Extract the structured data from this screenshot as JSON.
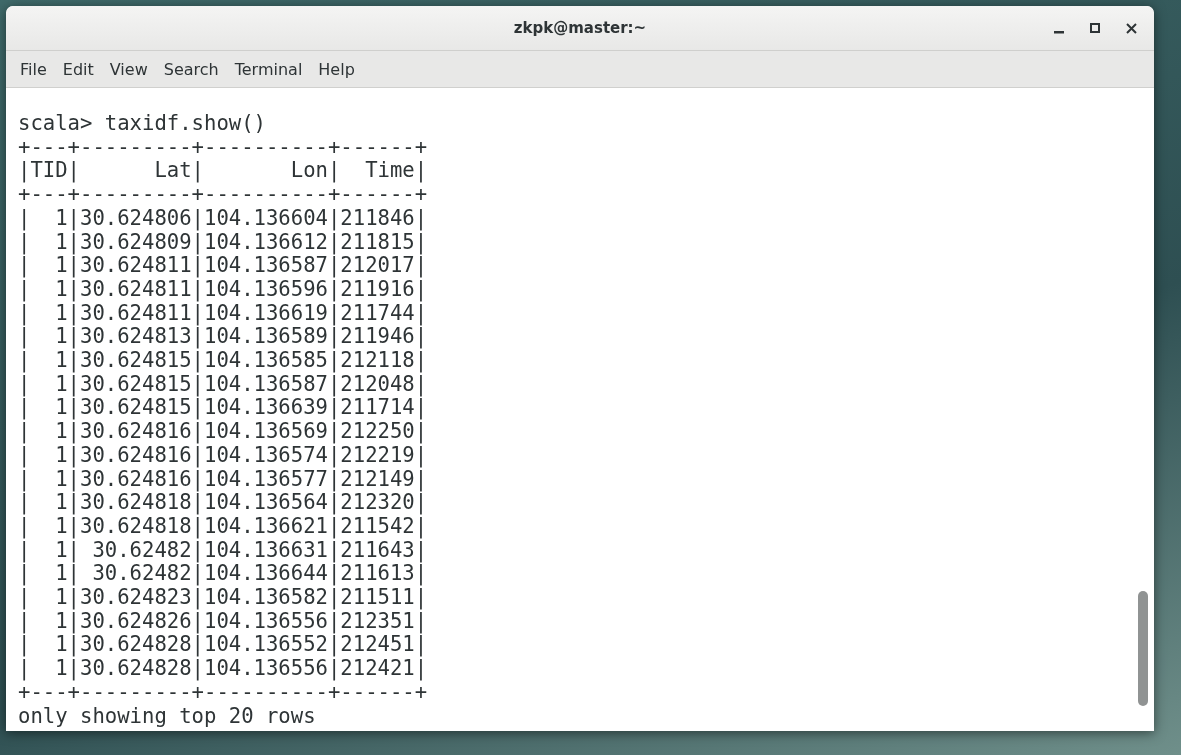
{
  "window": {
    "title": "zkpk@master:~"
  },
  "menu": [
    "File",
    "Edit",
    "View",
    "Search",
    "Terminal",
    "Help"
  ],
  "terminal": {
    "lines": [
      "scala> taxidf.show()",
      "+---+---------+----------+------+",
      "|TID|      Lat|       Lon|  Time|",
      "+---+---------+----------+------+",
      "|  1|30.624806|104.136604|211846|",
      "|  1|30.624809|104.136612|211815|",
      "|  1|30.624811|104.136587|212017|",
      "|  1|30.624811|104.136596|211916|",
      "|  1|30.624811|104.136619|211744|",
      "|  1|30.624813|104.136589|211946|",
      "|  1|30.624815|104.136585|212118|",
      "|  1|30.624815|104.136587|212048|",
      "|  1|30.624815|104.136639|211714|",
      "|  1|30.624816|104.136569|212250|",
      "|  1|30.624816|104.136574|212219|",
      "|  1|30.624816|104.136577|212149|",
      "|  1|30.624818|104.136564|212320|",
      "|  1|30.624818|104.136621|211542|",
      "|  1| 30.62482|104.136631|211643|",
      "|  1| 30.62482|104.136644|211613|",
      "|  1|30.624823|104.136582|211511|",
      "|  1|30.624826|104.136556|212351|",
      "|  1|30.624828|104.136552|212451|",
      "|  1|30.624828|104.136556|212421|",
      "+---+---------+----------+------+",
      "only showing top 20 rows"
    ]
  }
}
